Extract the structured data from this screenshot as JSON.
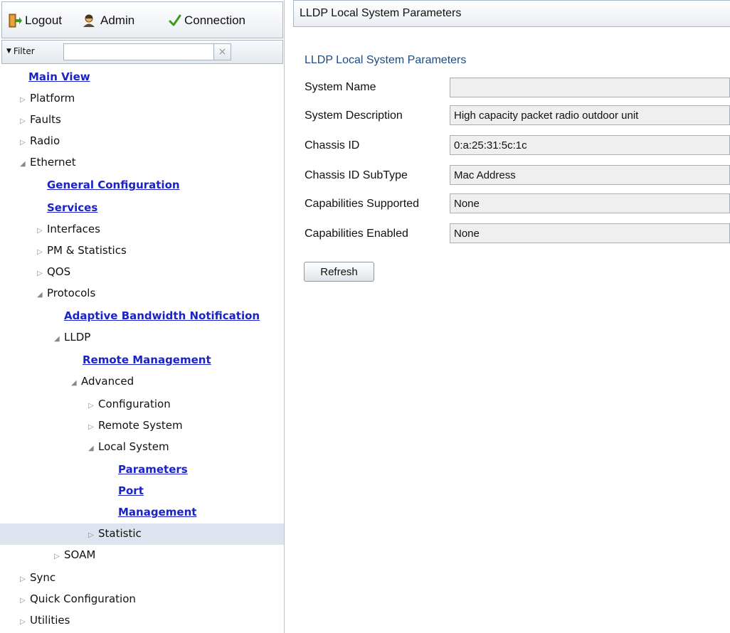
{
  "toolbar": {
    "logout_label": "Logout",
    "admin_label": "Admin",
    "connection_label": "Connection"
  },
  "filter": {
    "label": "Filter",
    "value": "",
    "clear_symbol": "×"
  },
  "tree": {
    "main_view": "Main View",
    "platform": "Platform",
    "faults": "Faults",
    "radio": "Radio",
    "ethernet": "Ethernet",
    "general_configuration": "General Configuration",
    "services": "Services",
    "interfaces": "Interfaces",
    "pm_statistics": "PM & Statistics",
    "qos": "QOS",
    "protocols": "Protocols",
    "adaptive_bandwidth_notification": "Adaptive Bandwidth Notification",
    "lldp": "LLDP",
    "remote_management": "Remote Management",
    "advanced": "Advanced",
    "configuration": "Configuration",
    "remote_system": "Remote System",
    "local_system": "Local System",
    "parameters": "Parameters",
    "port": "Port",
    "management": "Management",
    "statistic": "Statistic",
    "soam": "SOAM",
    "sync": "Sync",
    "quick_configuration": "Quick Configuration",
    "utilities": "Utilities"
  },
  "icons": {
    "collapsed": "chevron-right-icon",
    "expanded": "chevron-down-icon",
    "logout": "door-exit-icon",
    "admin": "user-icon",
    "connection": "checkmark-icon"
  },
  "colors": {
    "link": "#1a23c8",
    "section_title": "#1e4a83",
    "selection": "#dde4ef",
    "connection_check": "#3c9a1e"
  },
  "panel": {
    "header_title": "LLDP Local System Parameters",
    "section_title": "LLDP Local System Parameters",
    "fields": {
      "system_name": {
        "label": "System Name",
        "value": ""
      },
      "system_description": {
        "label": "System Description",
        "value": "High capacity packet radio outdoor unit"
      },
      "chassis_id": {
        "label": "Chassis ID",
        "value": "0:a:25:31:5c:1c"
      },
      "chassis_id_subtype": {
        "label": "Chassis ID SubType",
        "value": "Mac Address"
      },
      "capabilities_supported": {
        "label": "Capabilities Supported",
        "value": "None"
      },
      "capabilities_enabled": {
        "label": "Capabilities Enabled",
        "value": "None"
      }
    },
    "refresh_label": "Refresh"
  }
}
